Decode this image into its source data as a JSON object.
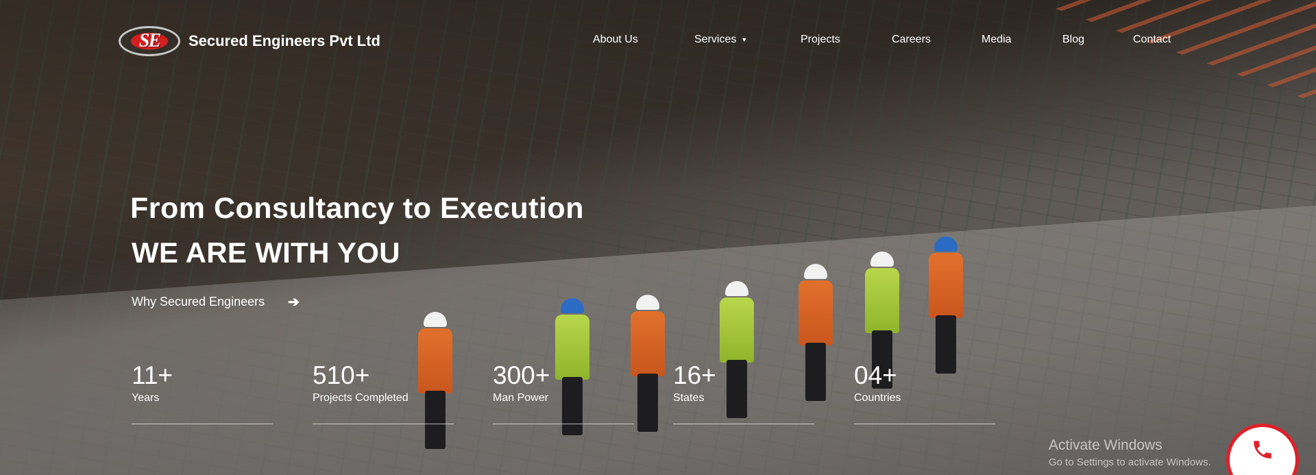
{
  "brand": {
    "name": "Secured Engineers Pvt Ltd",
    "logo_letters": "SE"
  },
  "nav": {
    "items": [
      {
        "label": "About Us"
      },
      {
        "label": "Services",
        "has_dropdown": true
      },
      {
        "label": "Projects"
      },
      {
        "label": "Careers"
      },
      {
        "label": "Media"
      },
      {
        "label": "Blog"
      },
      {
        "label": "Contact"
      }
    ]
  },
  "hero": {
    "title": "From Consultancy to Execution",
    "subtitle": "WE ARE WITH YOU",
    "cta_label": "Why Secured Engineers",
    "cta_icon": "arrow-right-icon"
  },
  "stats": [
    {
      "value": "11+",
      "label": "Years"
    },
    {
      "value": "510+",
      "label": "Projects Completed"
    },
    {
      "value": "300+",
      "label": "Man Power"
    },
    {
      "value": "16+",
      "label": "States"
    },
    {
      "value": "04+",
      "label": "Countries"
    }
  ],
  "watermark": {
    "title": "Activate Windows",
    "subtitle": "Go to Settings to activate Windows."
  },
  "call_button": {
    "icon": "phone-icon",
    "color": "#e0202a"
  }
}
